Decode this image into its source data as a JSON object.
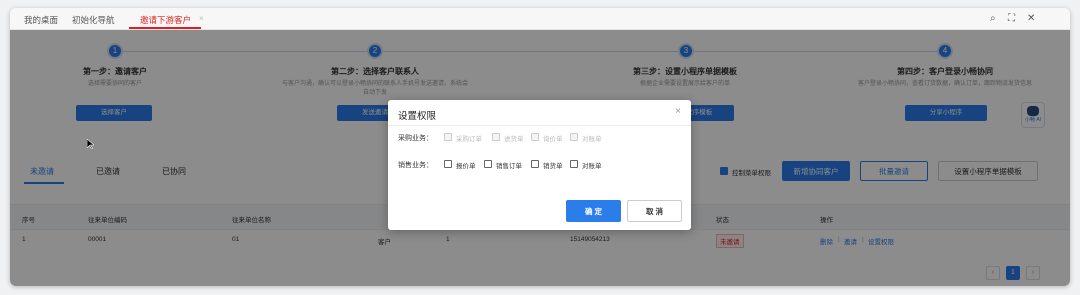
{
  "tabs": [
    {
      "label": "我的桌面"
    },
    {
      "label": "初始化导航"
    },
    {
      "label": "邀请下游客户",
      "active": true
    }
  ],
  "window_icons": [
    "search-icon",
    "fullscreen-icon",
    "close-icon"
  ],
  "steps": [
    {
      "num": "1",
      "title": "第一步：邀请客户",
      "desc": "选择需要协同的客户",
      "button": "选择客户"
    },
    {
      "num": "2",
      "title": "第二步：选择客户联系人",
      "desc": "与客户沟通，确认可以登录小畅协同的联系人手机号发送邀请，系统会自动下发",
      "button": "发送邀请"
    },
    {
      "num": "3",
      "title": "第三步：设置小程序单据模板",
      "desc": "根据企业需要设置展示给客户的单",
      "button": "小程序模板"
    },
    {
      "num": "4",
      "title": "第四步：客户登录小畅协同",
      "desc": "客户登录小畅协同，查看订货数据，确认订单，跟踪物流发货信息",
      "button": "分享小程序"
    }
  ],
  "assistant": {
    "label": "小畅 AI"
  },
  "subtabs": [
    "未邀请",
    "已邀请",
    "已协同"
  ],
  "controls": {
    "menu_perm_label": "控制菜单权限",
    "add_button": "新增协同客户",
    "batch_button": "批量邀请",
    "template_button": "设置小程序单据模板"
  },
  "table": {
    "headers": [
      "序号",
      "往来单位编码",
      "往来单位名称",
      "状态",
      "操作"
    ],
    "rows": [
      {
        "index": "1",
        "code": "00001",
        "name": "01",
        "type": "客户",
        "contact": "1",
        "phone": "15149054213",
        "status": "未邀请",
        "actions": [
          "删除",
          "邀请",
          "设置权限"
        ]
      }
    ]
  },
  "pagination": {
    "current": "1"
  },
  "modal": {
    "title": "设置权限",
    "purchase_label": "采购业务：",
    "purchase_options": [
      "采购订单",
      "进货单",
      "询价单",
      "对账单"
    ],
    "sales_label": "销售业务：",
    "sales_options": [
      "报价单",
      "销售订单",
      "销货单",
      "对账单"
    ],
    "confirm": "确 定",
    "cancel": "取 消"
  },
  "colors": {
    "accent": "#2b7de9",
    "active_tab": "#e02020"
  }
}
